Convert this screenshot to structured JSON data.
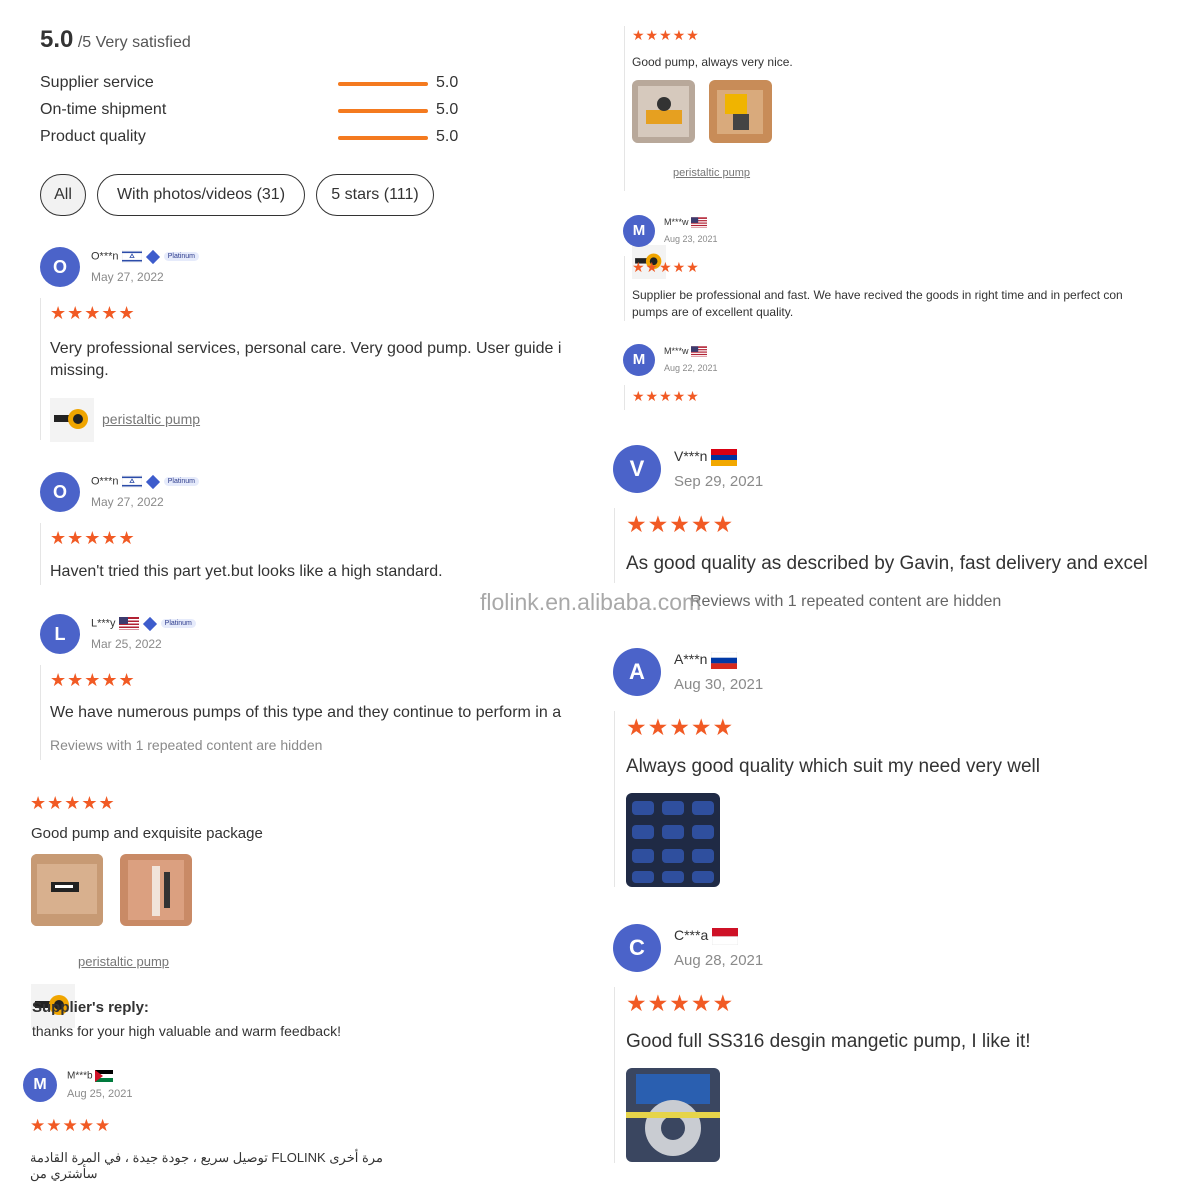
{
  "summary": {
    "score": "5.0",
    "suffix": "/5 Very satisfied",
    "rows": [
      {
        "label": "Supplier service",
        "value": "5.0"
      },
      {
        "label": "On-time shipment",
        "value": "5.0"
      },
      {
        "label": "Product quality",
        "value": "5.0"
      }
    ]
  },
  "filters": [
    "All",
    "With photos/videos (31)",
    "5 stars (111)"
  ],
  "stars": "★★★★★",
  "reviews_left": [
    {
      "initial": "O",
      "name": "O***n",
      "badge": "Platinum",
      "date": "May 27, 2022",
      "text1": "Very professional services, personal care. Very good pump. User guide i",
      "text2": "missing.",
      "product": "peristaltic pump"
    },
    {
      "initial": "O",
      "name": "O***n",
      "badge": "Platinum",
      "date": "May 27, 2022",
      "text": "Haven't tried this part yet.but looks like a high standard."
    },
    {
      "initial": "L",
      "name": "L***y",
      "badge": "Platinum",
      "date": "Mar 25, 2022",
      "text": "We have numerous pumps of this type and they continue to perform in a",
      "hidden": "Reviews with 1 repeated content are hidden"
    }
  ],
  "left_lower": {
    "text": "Good pump and exquisite package",
    "product": "peristaltic pump",
    "reply_title": "Supplier's reply:",
    "reply_text": "thanks for your high valuable and warm feedback!",
    "reviewer": {
      "initial": "M",
      "name": "M***b",
      "date": "Aug 25, 2021"
    },
    "arabic": "مرة أخرى FLOLINK توصيل سريع ، جودة جيدة ، في المرة القادمة سأشتري من"
  },
  "right_top": {
    "text": "Good pump, always very nice.",
    "product": "peristaltic pump",
    "r1": {
      "initial": "M",
      "name": "M***w",
      "date": "Aug 23, 2021",
      "text1": "Supplier be professional and fast. We have recived the goods in right time and in perfect con",
      "text2": "pumps are of excellent quality."
    },
    "r2": {
      "initial": "M",
      "name": "M***w",
      "date": "Aug 22, 2021"
    }
  },
  "right_big": [
    {
      "initial": "V",
      "name": "V***n",
      "date": "Sep 29, 2021",
      "text": "As good quality as described by Gavin, fast delivery and excel"
    },
    {
      "initial": "A",
      "name": "A***n",
      "date": "Aug 30, 2021",
      "text": "Always good quality which suit my need very well"
    },
    {
      "initial": "C",
      "name": "C***a",
      "date": "Aug 28, 2021",
      "text": "Good full SS316 desgin mangetic pump, I like it!"
    }
  ],
  "watermark": "flolink.en.alibaba.com",
  "hidden_right": "Reviews with 1 repeated content are hidden",
  "colors": {
    "accent": "#f15a24",
    "avatar": "#4b63c9",
    "bar": "#f47a1f"
  }
}
